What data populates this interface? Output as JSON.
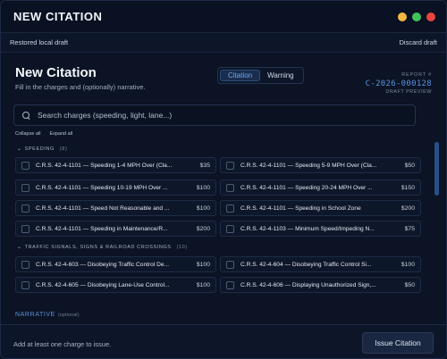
{
  "window": {
    "title": "NEW CITATION",
    "dots": [
      "#f5b843",
      "#43c25a",
      "#e8453c"
    ]
  },
  "draft": {
    "status": "Restored local draft",
    "discard": "Discard draft"
  },
  "header": {
    "title": "New Citation",
    "subtitle": "Fill in the charges and (optionally) narrative."
  },
  "tabs": [
    "Citation",
    "Warning"
  ],
  "report": {
    "label": "REPORT #",
    "number": "C-2026-000128",
    "preview": "DRAFT PREVIEW"
  },
  "search": {
    "placeholder": "Search charges (speeding, light, lane...)"
  },
  "collapse_all": "Collapse all",
  "expand_all": "Expand all",
  "categories": [
    {
      "name": "SPEEDING",
      "count": "(8)",
      "charges": [
        {
          "text": "C.R.S. 42-4-1101 — Speeding 1-4 MPH Over (Cla...",
          "amount": "$35"
        },
        {
          "text": "C.R.S. 42-4-1101 — Speeding 5-9 MPH Over (Cla...",
          "amount": "$50"
        },
        {
          "text": "C.R.S. 42-4-1101 — Speeding 10-19 MPH Over ...",
          "amount": "$100"
        },
        {
          "text": "C.R.S. 42-4-1101 — Speeding 20-24 MPH Over ...",
          "amount": "$150"
        },
        {
          "text": "C.R.S. 42-4-1101 — Speed Not Reasonable and ...",
          "amount": "$100"
        },
        {
          "text": "C.R.S. 42-4-1101 — Speeding in School Zone",
          "amount": "$200"
        },
        {
          "text": "C.R.S. 42-4-1101 — Speeding in Maintenance/R...",
          "amount": "$200"
        },
        {
          "text": "C.R.S. 42-4-1103 — Minimum Speed/Impeding N...",
          "amount": "$75"
        }
      ]
    },
    {
      "name": "TRAFFIC SIGNALS, SIGNS & RAILROAD CROSSINGS",
      "count": "(10)",
      "charges": [
        {
          "text": "C.R.S. 42-4-603 — Disobeying Traffic Control De...",
          "amount": "$100"
        },
        {
          "text": "C.R.S. 42-4-604 — Disobeying Traffic Control Si...",
          "amount": "$100"
        },
        {
          "text": "C.R.S. 42-4-605 — Disobeying Lane-Use Control...",
          "amount": "$100"
        },
        {
          "text": "C.R.S. 42-4-606 — Displaying Unauthorized Sign,...",
          "amount": "$50"
        }
      ]
    }
  ],
  "narrative": {
    "label": "NARRATIVE",
    "optional": "(optional)"
  },
  "footer": {
    "message": "Add at least one charge to issue.",
    "issue_button": "Issue Citation"
  }
}
